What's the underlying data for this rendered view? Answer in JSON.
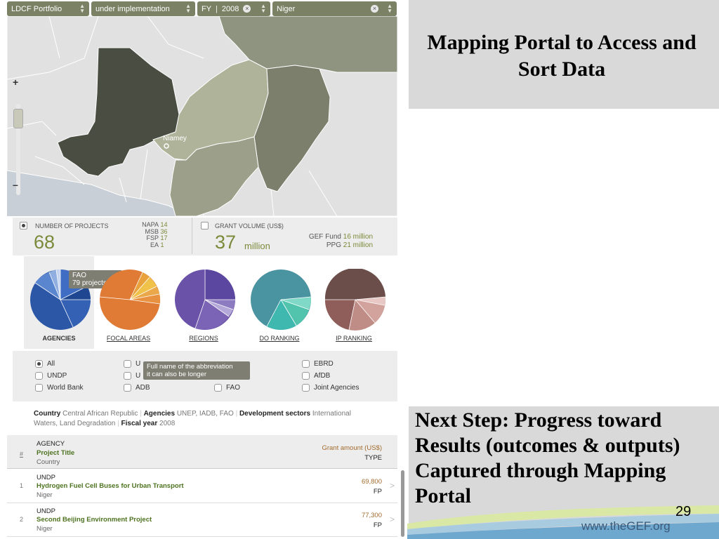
{
  "filters": {
    "portfolio": "LDCF Portfolio",
    "status": "under implementation",
    "fy_label": "FY",
    "fy_value": "2008",
    "country": "Niger"
  },
  "map": {
    "zoom_in": "+",
    "zoom_out": "–",
    "city_label": "Niamey"
  },
  "stats": {
    "projects_label": "NUMBER OF PROJECTS",
    "projects_count": "68",
    "breakdown": [
      {
        "k": "NAPA",
        "v": "14"
      },
      {
        "k": "MSB",
        "v": "36"
      },
      {
        "k": "FSP",
        "v": "17"
      },
      {
        "k": "EA",
        "v": "1"
      }
    ],
    "grant_label": "GRANT VOLUME (US$)",
    "grant_value": "37",
    "grant_unit": "million",
    "funds": [
      {
        "k": "GEF Fund",
        "v": "16 million"
      },
      {
        "k": "PPG",
        "v": "21 million"
      }
    ]
  },
  "charts": {
    "tabs": [
      "AGENCIES",
      "FOCAL AREAS",
      "REGIONS",
      "DO RANKING",
      "IP RANKING"
    ],
    "tooltip_name": "FAO",
    "tooltip_value": "79 projects",
    "colors": [
      "#2c56a6",
      "#e07b35",
      "#6a52a8",
      "#4a93a0",
      "#6b4d4a"
    ]
  },
  "agencies": {
    "options": [
      "All",
      "UNDP",
      "World Bank",
      "U",
      "U",
      "ADB",
      "FAO",
      "EBRD",
      "AfDB",
      "Joint Agencies"
    ],
    "tooltip_line1": "Full name of the abbreviation",
    "tooltip_line2": "it can also be longer"
  },
  "summary": {
    "country_k": "Country",
    "country_v": "Central African Republic",
    "agencies_k": "Agencies",
    "agencies_v": "UNEP, IADB, FAO",
    "sectors_k": "Development sectors",
    "sectors_v": "International",
    "sectors_v2": "Waters, Land Degradation",
    "fy_k": "Fiscal year",
    "fy_v": "2008"
  },
  "table": {
    "h_num": "#",
    "h_agency": "AGENCY",
    "h_title": "Project Title",
    "h_country": "Country",
    "h_amount": "Grant amount (US$)",
    "h_type": "TYPE",
    "rows": [
      {
        "num": "1",
        "agency": "UNDP",
        "title": "Hydrogen Fuel Cell Buses for Urban Transport",
        "country": "Niger",
        "amount": "69,800",
        "type": "FP"
      },
      {
        "num": "2",
        "agency": "UNDP",
        "title": "Second Beijing Environment Project",
        "country": "Niger",
        "amount": "77,300",
        "type": "FP"
      }
    ]
  },
  "slide": {
    "title": "Mapping Portal to Access and Sort Data",
    "next_step": "Next Step: Progress toward Results (outcomes & outputs) Captured through Mapping Portal",
    "page": "29",
    "url": "www.theGEF.org"
  }
}
